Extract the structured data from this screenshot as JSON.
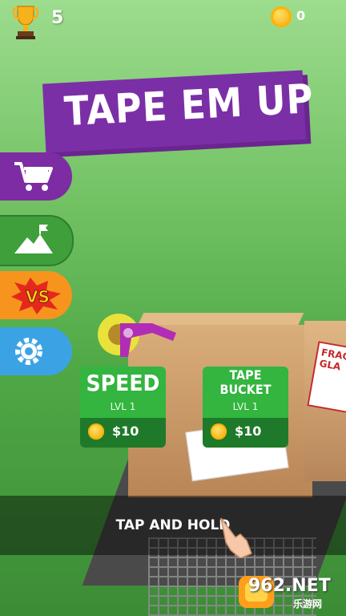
{
  "hud": {
    "trophy_count": "5",
    "coin_count": "0",
    "icons": [
      "trophy-icon",
      "coin-icon"
    ]
  },
  "title": "TAPE EM UP",
  "side_menu": [
    {
      "name": "shop",
      "icon": "shopping-cart-icon",
      "color": "#7d2ca3"
    },
    {
      "name": "levels",
      "icon": "mountain-flag-icon",
      "color": "#3e9f3b"
    },
    {
      "name": "versus",
      "label": "VS",
      "icon": "versus-badge-icon",
      "color": "#f7941d"
    },
    {
      "name": "settings",
      "icon": "gear-icon",
      "color": "#3ba3e3"
    }
  ],
  "upgrades": {
    "speed": {
      "title": "SPEED",
      "level": "LVL 1",
      "price": "$10"
    },
    "bucket": {
      "title_line1": "TAPE",
      "title_line2": "BUCKET",
      "level": "LVL 1",
      "price": "$10"
    }
  },
  "scene": {
    "fragile_label": "FRAG GLA"
  },
  "instruction": "TAP AND HOLD",
  "watermark": {
    "site": "962.NET",
    "name": "乐游网"
  },
  "colors": {
    "card_green": "#33b53f",
    "banner_purple": "#7b2fa6",
    "coin_gold": "#f5a300"
  }
}
